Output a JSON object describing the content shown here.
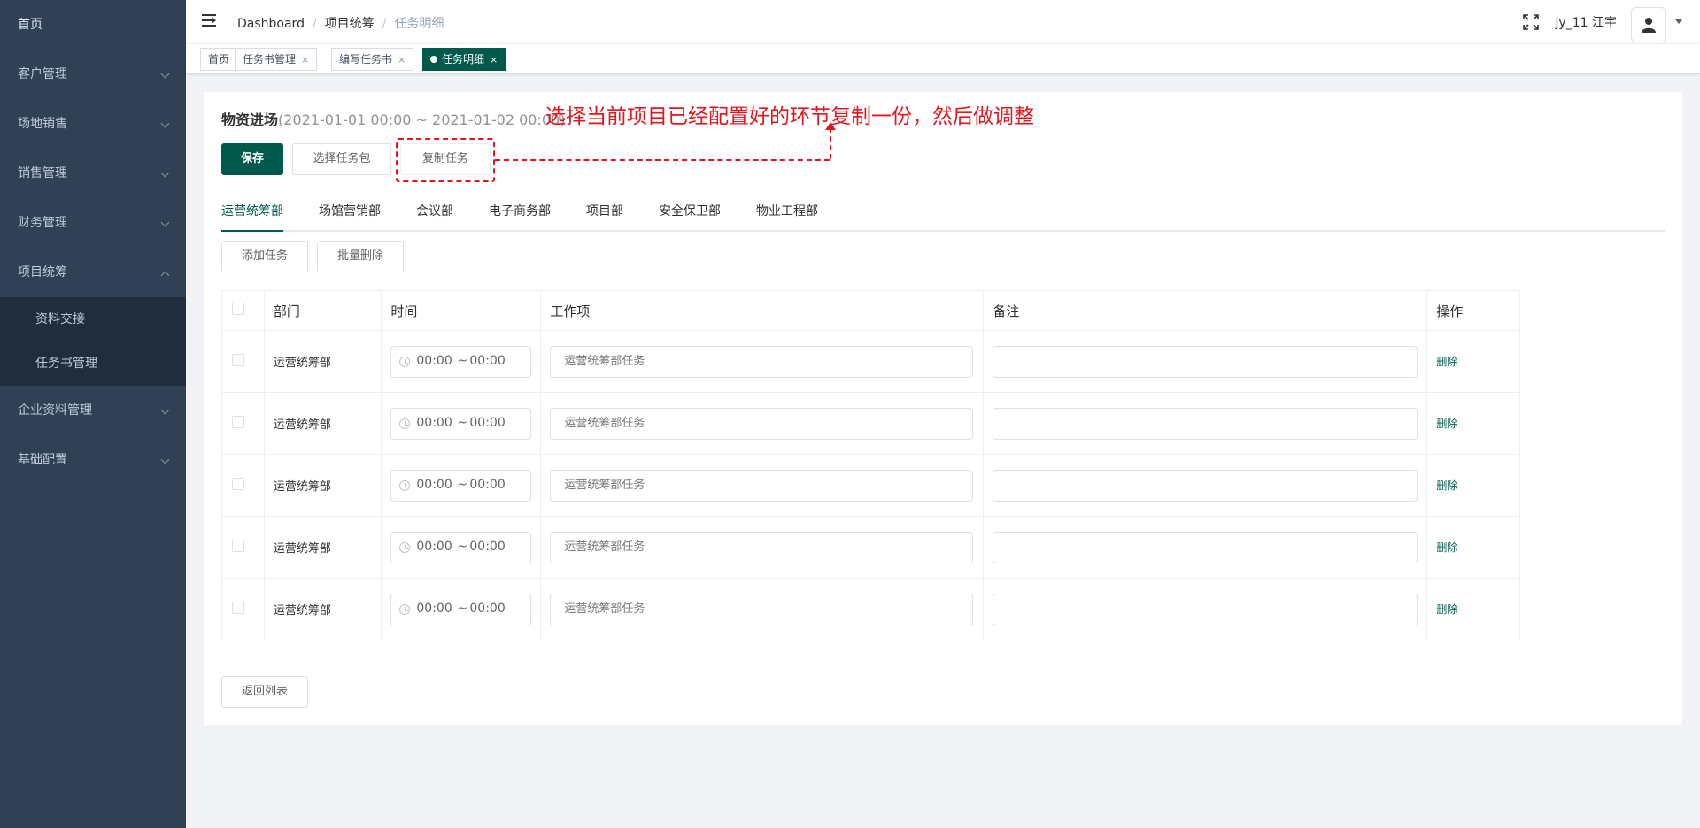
{
  "sidebar": {
    "items": [
      {
        "label": "首页"
      },
      {
        "label": "客户管理"
      },
      {
        "label": "场地销售"
      },
      {
        "label": "销售管理"
      },
      {
        "label": "财务管理"
      },
      {
        "label": "项目统筹"
      },
      {
        "label": "企业资料管理"
      },
      {
        "label": "基础配置"
      }
    ],
    "submenu": [
      {
        "label": "资料交接"
      },
      {
        "label": "任务书管理"
      }
    ]
  },
  "navbar": {
    "breadcrumb": [
      "Dashboard",
      "项目统筹",
      "任务明细"
    ],
    "username": "jy_11 江宇"
  },
  "tags": [
    {
      "label": "首页"
    },
    {
      "label": "任务书管理"
    },
    {
      "label": "编写任务书"
    },
    {
      "label": "任务明细"
    }
  ],
  "page": {
    "title": "物资进场",
    "date_range": "(2021-01-01 00:00 ~ 2021-01-02 00:00)",
    "annotation": "选择当前项目已经配置好的环节复制一份，然后做调整",
    "buttons": {
      "save": "保存",
      "select_package": "选择任务包",
      "copy_task": "复制任务"
    },
    "tabs": [
      "运营统筹部",
      "场馆营销部",
      "会议部",
      "电子商务部",
      "项目部",
      "安全保卫部",
      "物业工程部"
    ],
    "actions": {
      "add_task": "添加任务",
      "batch_delete": "批量删除"
    },
    "table": {
      "headers": {
        "dept": "部门",
        "time": "时间",
        "work": "工作项",
        "note": "备注",
        "op": "操作"
      },
      "rows": [
        {
          "dept": "运营统筹部",
          "start": "00:00",
          "end": "00:00",
          "work_placeholder": "运营统筹部任务",
          "note": "",
          "op": "删除"
        },
        {
          "dept": "运营统筹部",
          "start": "00:00",
          "end": "00:00",
          "work_placeholder": "运营统筹部任务",
          "note": "",
          "op": "删除"
        },
        {
          "dept": "运营统筹部",
          "start": "00:00",
          "end": "00:00",
          "work_placeholder": "运营统筹部任务",
          "note": "",
          "op": "删除"
        },
        {
          "dept": "运营统筹部",
          "start": "00:00",
          "end": "00:00",
          "work_placeholder": "运营统筹部任务",
          "note": "",
          "op": "删除"
        },
        {
          "dept": "运营统筹部",
          "start": "00:00",
          "end": "00:00",
          "work_placeholder": "运营统筹部任务",
          "note": "",
          "op": "删除"
        }
      ]
    },
    "back_button": "返回列表"
  },
  "colors": {
    "accent": "#005a4b",
    "sidebar_bg": "#304156",
    "submenu_bg": "#1f2d3d",
    "annotation": "#e8141b"
  }
}
